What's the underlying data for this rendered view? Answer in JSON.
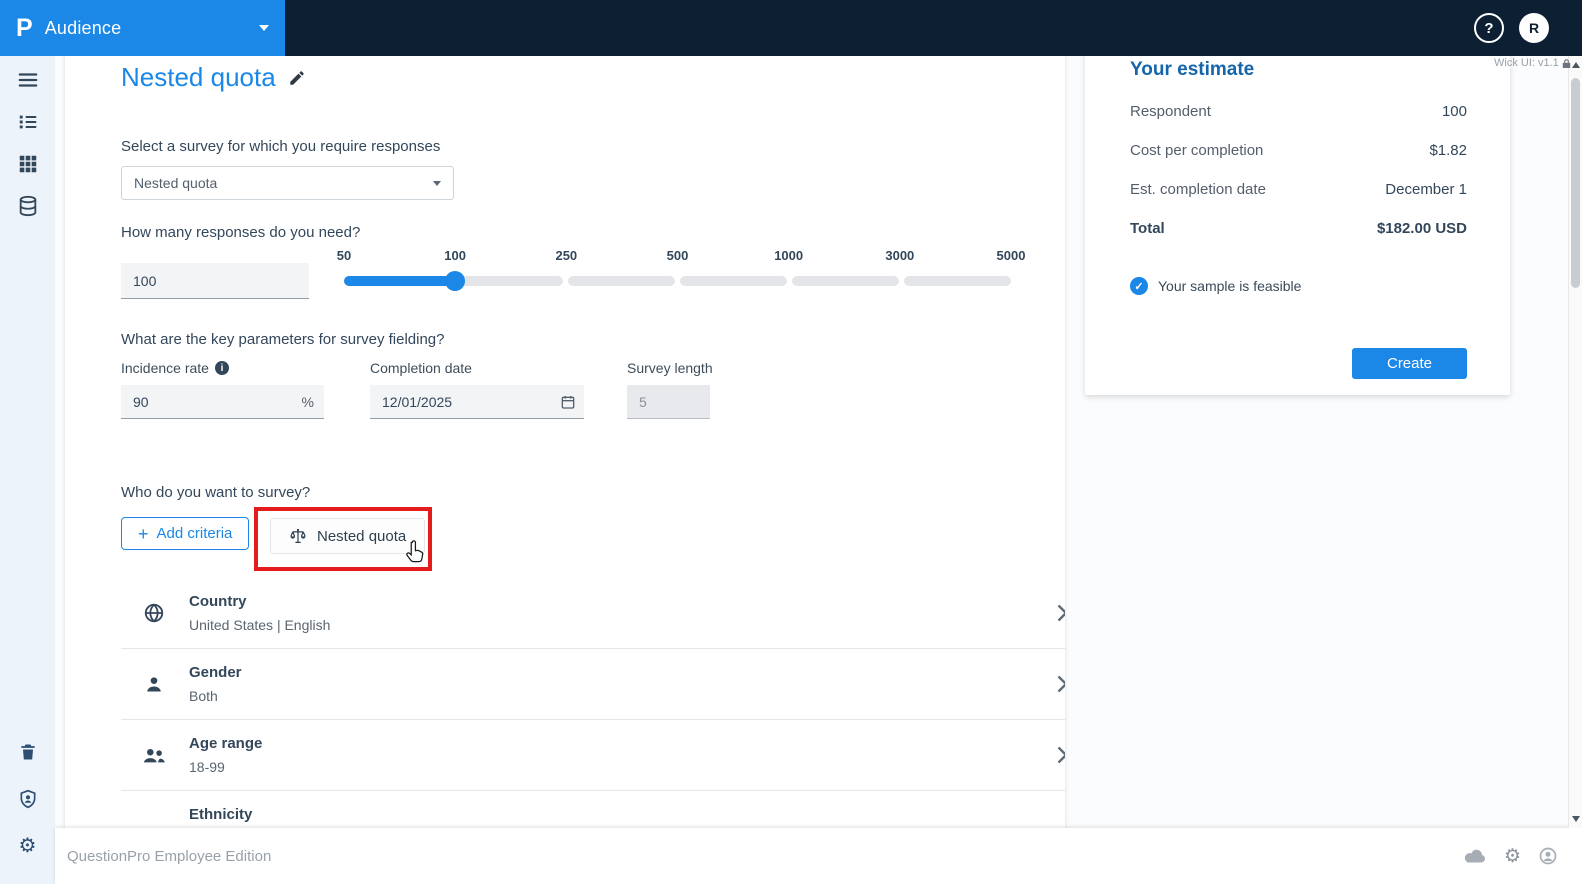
{
  "topbar": {
    "logo_letter": "P",
    "product": "Audience",
    "help": "?",
    "avatar": "R"
  },
  "version_label": "Wick UI: v1.1",
  "page": {
    "title": "Nested quota"
  },
  "survey_select": {
    "label": "Select a survey for which you require responses",
    "value": "Nested quota"
  },
  "responses": {
    "label": "How many responses do you need?",
    "value": "100",
    "ticks": [
      "50",
      "100",
      "250",
      "500",
      "1000",
      "3000",
      "5000"
    ]
  },
  "parameters": {
    "label": "What are the key parameters for survey fielding?",
    "incidence": {
      "label": "Incidence rate",
      "value": "90",
      "suffix": "%"
    },
    "completion": {
      "label": "Completion date",
      "value": "12/01/2025"
    },
    "length": {
      "label": "Survey length",
      "value": "5"
    }
  },
  "audience": {
    "label": "Who do you want to survey?",
    "add_button": "Add criteria",
    "nested_button": "Nested quota",
    "criteria": [
      {
        "title": "Country",
        "subtitle": "United States | English"
      },
      {
        "title": "Gender",
        "subtitle": "Both"
      },
      {
        "title": "Age range",
        "subtitle": "18-99"
      },
      {
        "title": "Ethnicity",
        "subtitle": ""
      }
    ]
  },
  "estimate": {
    "title": "Your estimate",
    "rows": [
      {
        "label": "Respondent",
        "value": "100"
      },
      {
        "label": "Cost per completion",
        "value": "$1.82"
      },
      {
        "label": "Est. completion date",
        "value": "December 1"
      },
      {
        "label": "Total",
        "value": "$182.00 USD"
      }
    ],
    "feasible": "Your sample is feasible",
    "create": "Create"
  },
  "footer": {
    "text": "QuestionPro Employee Edition"
  },
  "colors": {
    "accent": "#1b87e6",
    "topbar_bg": "#0d2033",
    "sidebar_bg": "#edf3fa",
    "estimate_title": "#1565ab",
    "annotation_red": "#e51c1c"
  },
  "icons": {
    "plus": "+",
    "check": "✓",
    "gear": "⚙",
    "info": "i"
  }
}
